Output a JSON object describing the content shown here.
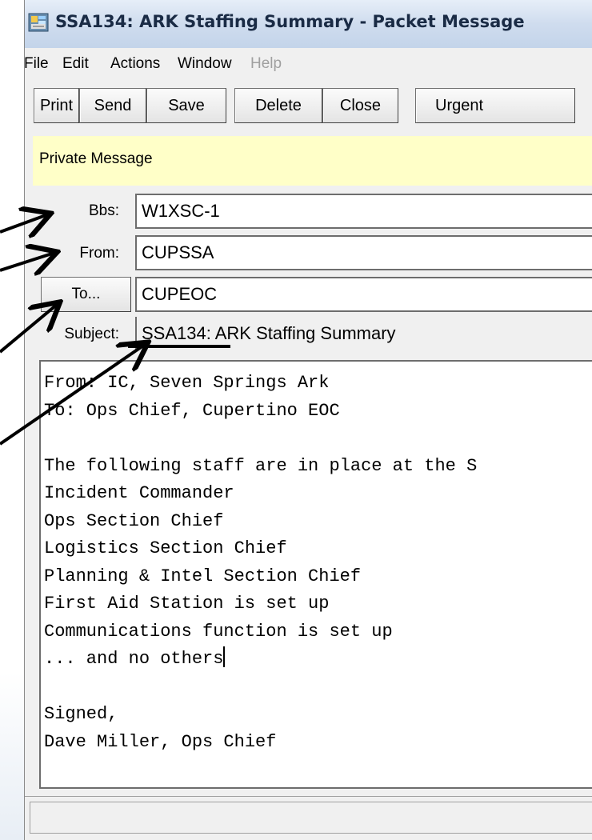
{
  "window": {
    "title": "SSA134: ARK Staffing Summary - Packet Message"
  },
  "menu": [
    "File",
    "Edit",
    "Actions",
    "Window",
    "Help"
  ],
  "toolbar": {
    "print": "Print",
    "send": "Send",
    "save": "Save",
    "delete": "Delete",
    "close": "Close",
    "urgent": "Urgent"
  },
  "status": "Private Message",
  "fields": {
    "bbs_label": "Bbs:",
    "bbs_value": "W1XSC-1",
    "from_label": "From:",
    "from_value": "CUPSSA",
    "to_button": "To...",
    "to_value": "CUPEOC",
    "subject_label": "Subject:",
    "subject_prefix": "SSA134:",
    "subject_rest": " ARK Staffing Summary"
  },
  "body_lines": [
    "From: IC, Seven Springs Ark",
    "To: Ops Chief, Cupertino EOC",
    "",
    "The following staff are in place at the S",
    "Incident Commander",
    "Ops Section Chief",
    "Logistics Section Chief",
    "Planning & Intel Section Chief",
    "First Aid Station is set up",
    "Communications function is set up",
    "... and no others",
    "",
    "Signed,",
    "Dave Miller, Ops Chief"
  ],
  "icons": {
    "app": "packet-radio-app-icon"
  }
}
